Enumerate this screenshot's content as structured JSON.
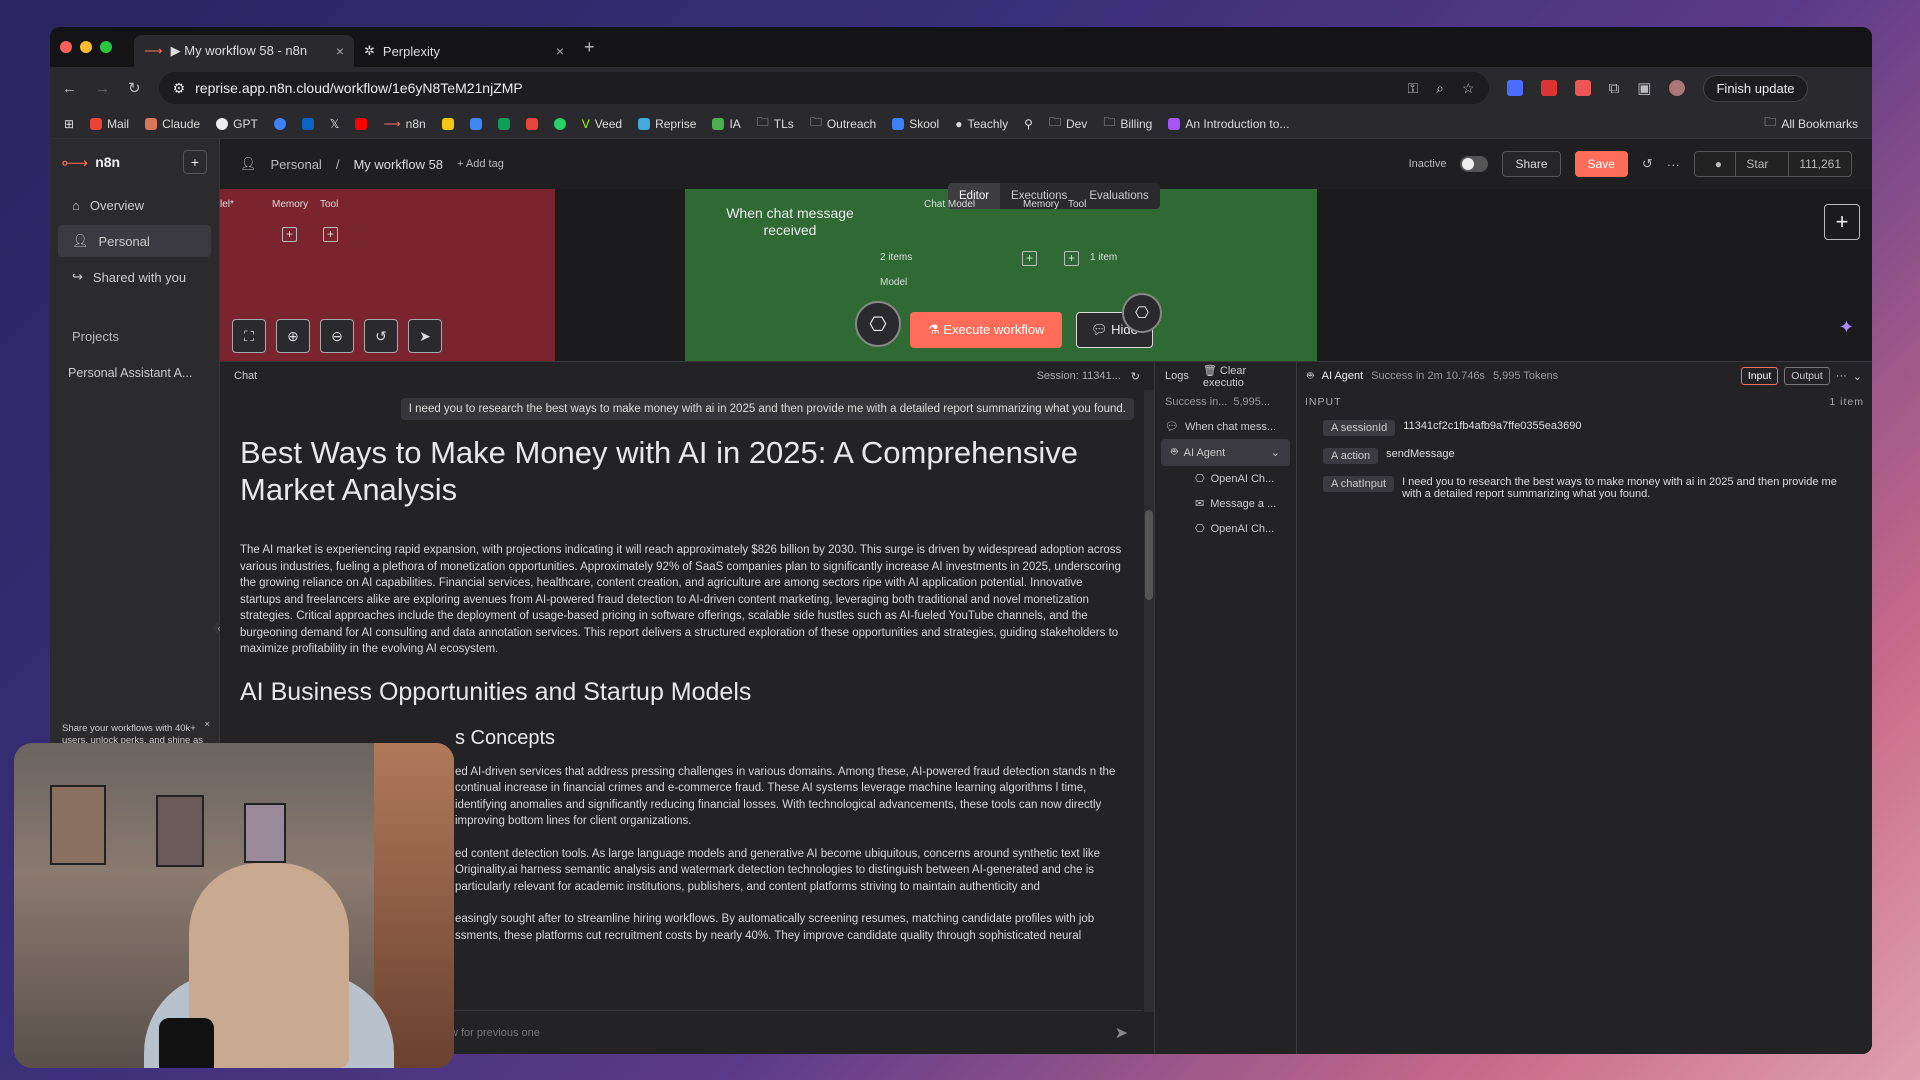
{
  "browser": {
    "tabs": [
      {
        "label": "▶ My workflow 58 - n8n",
        "active": true
      },
      {
        "label": "Perplexity",
        "active": false
      }
    ],
    "url": "reprise.app.n8n.cloud/workflow/1e6yN8TeM21njZMP",
    "finish_update": "Finish update",
    "bookmarks": [
      "Mail",
      "Claude",
      "GPT",
      "Veed",
      "Reprise",
      "IA",
      "TLs",
      "Outreach",
      "Skool",
      "Teachly",
      "Dev",
      "Billing",
      "An Introduction to..."
    ],
    "all_bookmarks": "All Bookmarks"
  },
  "sidebar": {
    "brand": "n8n",
    "items": [
      {
        "label": "Overview",
        "icon": "home-icon"
      },
      {
        "label": "Personal",
        "icon": "user-icon"
      },
      {
        "label": "Shared with you",
        "icon": "share-icon"
      }
    ],
    "projects_heading": "Projects",
    "project_item": "Personal Assistant A...",
    "promo": "Share your workflows with 40k+ users, unlock perks, and shine as a featured template creator!"
  },
  "header": {
    "crumb_personal": "Personal",
    "workflow_name": "My workflow 58",
    "add_tag": "+ Add tag",
    "status": "Inactive",
    "share": "Share",
    "save": "Save",
    "star": "Star",
    "star_count": "111,261"
  },
  "canvas": {
    "tabs": [
      "Editor",
      "Executions",
      "Evaluations"
    ],
    "red_labels": [
      "lel*",
      "Memory",
      "Tool"
    ],
    "chat_trigger": "When chat message received",
    "green_labels": [
      "Chat Model",
      "Memory",
      "Tool",
      "Model"
    ],
    "items_left": "2 items",
    "items_right": "1 item",
    "execute": "Execute workflow",
    "hide": "Hide"
  },
  "chat": {
    "title": "Chat",
    "session": "Session: 11341...",
    "user_message": "I need you to research the best ways to make money with ai in 2025 and then provide me with a detailed report summarizing what you found.",
    "h1": "Best Ways to Make Money with AI in 2025: A Comprehensive Market Analysis",
    "intro": "The AI market is experiencing rapid expansion, with projections indicating it will reach approximately $826 billion by 2030. This surge is driven by widespread adoption across various industries, fueling a plethora of monetization opportunities. Approximately 92% of SaaS companies plan to significantly increase AI investments in 2025, underscoring the growing reliance on AI capabilities. Financial services, healthcare, content creation, and agriculture are among sectors ripe with AI application potential. Innovative startups and freelancers alike are exploring avenues from AI-powered fraud detection to AI-driven content marketing, leveraging both traditional and novel monetization strategies. Critical approaches include the deployment of usage-based pricing in software offerings, scalable side hustles such as AI-fueled YouTube channels, and the burgeoning demand for AI consulting and data annotation services. This report delivers a structured exploration of these opportunities and strategies, guiding stakeholders to maximize profitability in the evolving AI ecosystem.",
    "h2": "AI Business Opportunities and Startup Models",
    "h3": "s Concepts",
    "frag1": "ed AI-driven services that address pressing challenges in various domains. Among these, AI-powered fraud detection stands n the continual increase in financial crimes and e-commerce fraud. These AI systems leverage machine learning algorithms l time, identifying anomalies and significantly reducing financial losses. With technological advancements, these tools can now directly improving bottom lines for client organizations.",
    "frag2": "ed content detection tools. As large language models and generative AI become ubiquitous, concerns around synthetic text like Originality.ai harness semantic analysis and watermark detection technologies to distinguish between AI-generated and che is particularly relevant for academic institutions, publishers, and content platforms striving to maintain authenticity and",
    "frag3": "easingly sought after to streamline hiring workflows. By automatically screening resumes, matching candidate profiles with job ssments, these platforms cut recruitment costs by nearly 40%. They improve candidate quality through sophisticated neural",
    "input_placeholder": "w for previous one"
  },
  "logs": {
    "title": "Logs",
    "clear": "Clear executio",
    "success": "Success in...",
    "tokens_short": "5,995...",
    "items": [
      {
        "label": "When chat mess...",
        "icon": "chat-icon"
      },
      {
        "label": "AI Agent",
        "icon": "robot-icon",
        "selected": true
      },
      {
        "label": "OpenAI Ch...",
        "icon": "openai-icon"
      },
      {
        "label": "Message a ...",
        "icon": "message-icon"
      },
      {
        "label": "OpenAI Ch...",
        "icon": "openai-icon"
      }
    ]
  },
  "agent": {
    "title": "AI Agent",
    "status": "Success in 2m 10.746s",
    "tokens": "5,995 Tokens",
    "input_btn": "Input",
    "output_btn": "Output",
    "input_heading": "INPUT",
    "items": "1 item",
    "fields": [
      {
        "key": "sessionId",
        "value": "11341cf2c1fb4afb9a7ffe0355ea3690"
      },
      {
        "key": "action",
        "value": "sendMessage"
      },
      {
        "key": "chatInput",
        "value": "I need you to research the best ways to make money with ai in 2025 and then provide me with a detailed report summarizing what you found."
      }
    ]
  }
}
